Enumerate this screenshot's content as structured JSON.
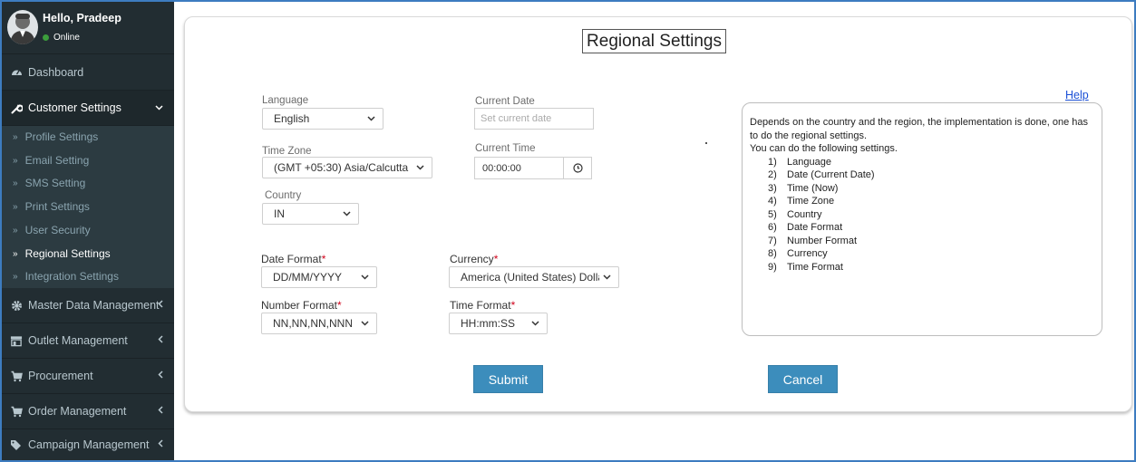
{
  "sidebar": {
    "user": {
      "greeting": "Hello, Pradeep",
      "status": "Online"
    },
    "menu": [
      {
        "label": "Dashboard",
        "icon": "dashboard-icon"
      },
      {
        "label": "Customer Settings",
        "icon": "wrench-icon",
        "expanded": true
      },
      {
        "label": "Master Data Management",
        "icon": "gear-icon"
      },
      {
        "label": "Outlet Management",
        "icon": "store-icon"
      },
      {
        "label": "Procurement",
        "icon": "cart-icon"
      },
      {
        "label": "Order Management",
        "icon": "cart-icon"
      },
      {
        "label": "Campaign Management",
        "icon": "tags-icon"
      }
    ],
    "submenu": [
      {
        "label": "Profile Settings"
      },
      {
        "label": "Email Setting"
      },
      {
        "label": "SMS Setting"
      },
      {
        "label": "Print Settings"
      },
      {
        "label": "User Security"
      },
      {
        "label": "Regional Settings",
        "active": true
      },
      {
        "label": "Integration Settings"
      }
    ]
  },
  "form": {
    "title": "Regional Settings",
    "language": {
      "label": "Language",
      "value": "English"
    },
    "current_date": {
      "label": "Current Date",
      "placeholder": "Set current date"
    },
    "time_zone": {
      "label": "Time Zone",
      "value": "(GMT +05:30) Asia/Calcutta"
    },
    "current_time": {
      "label": "Current Time",
      "value": "00:00:00"
    },
    "country": {
      "label": "Country",
      "value": "IN"
    },
    "date_format": {
      "label": "Date Format",
      "required_mark": "*",
      "value": "DD/MM/YYYY"
    },
    "currency": {
      "label": "Currency",
      "required_mark": "*",
      "value": "America (United States) Dollar;"
    },
    "number_format": {
      "label": "Number Format",
      "required_mark": "*",
      "value": "NN,NN,NN,NNN"
    },
    "time_format": {
      "label": "Time Format",
      "required_mark": "*",
      "value": "HH:mm:SS"
    },
    "submit_label": "Submit",
    "cancel_label": "Cancel"
  },
  "help": {
    "link_label": "Help",
    "intro": "Depends on the country and the region, the implementation is done, one has to do the regional settings.",
    "lead": "You can do the following settings.",
    "items": [
      {
        "num": "1)",
        "text": "Language"
      },
      {
        "num": "2)",
        "text": "Date (Current Date)"
      },
      {
        "num": "3)",
        "text": "Time (Now)"
      },
      {
        "num": "4)",
        "text": "Time Zone"
      },
      {
        "num": "5)",
        "text": "Country"
      },
      {
        "num": "6)",
        "text": "Date Format"
      },
      {
        "num": "7)",
        "text": "Number Format"
      },
      {
        "num": "8)",
        "text": "Currency"
      },
      {
        "num": "9)",
        "text": "Time Format"
      }
    ]
  },
  "colors": {
    "sidebar_bg": "#222d32",
    "submenu_bg": "#2c3b41",
    "accent_button": "#3c8dbc",
    "required": "#d0021b",
    "link": "#1a4fd6"
  }
}
